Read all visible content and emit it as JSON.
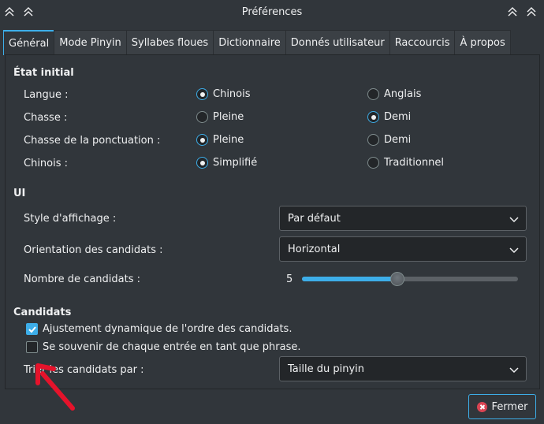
{
  "window": {
    "title": "Préférences"
  },
  "tabs": [
    {
      "label": "Général",
      "active": true
    },
    {
      "label": "Mode Pinyin",
      "active": false
    },
    {
      "label": "Syllabes floues",
      "active": false
    },
    {
      "label": "Dictionnaire",
      "active": false
    },
    {
      "label": "Donnés utilisateur",
      "active": false
    },
    {
      "label": "Raccourcis",
      "active": false
    },
    {
      "label": "À propos",
      "active": false
    }
  ],
  "initial_state": {
    "title": "État initial",
    "rows": [
      {
        "label": "Langue :",
        "option_a": "Chinois",
        "option_b": "Anglais",
        "selected": "a"
      },
      {
        "label": "Chasse :",
        "option_a": "Pleine",
        "option_b": "Demi",
        "selected": "b"
      },
      {
        "label": "Chasse de la ponctuation :",
        "option_a": "Pleine",
        "option_b": "Demi",
        "selected": "a"
      },
      {
        "label": "Chinois :",
        "option_a": "Simplifié",
        "option_b": "Traditionnel",
        "selected": "a"
      }
    ]
  },
  "ui": {
    "title": "UI",
    "display_style_label": "Style d'affichage :",
    "display_style_value": "Par défaut",
    "orientation_label": "Orientation des candidats :",
    "orientation_value": "Horizontal",
    "count_label": "Nombre de candidats :",
    "count_value": "5",
    "count_fraction": 0.44
  },
  "candidates": {
    "title": "Candidats",
    "dynamic_adjust_label": "Ajustement dynamique de l'ordre des candidats.",
    "dynamic_adjust_checked": true,
    "remember_label": "Se souvenir de chaque entrée en tant que phrase.",
    "remember_checked": false,
    "sort_label": "Trier les candidats par :",
    "sort_value": "Taille du pinyin"
  },
  "footer": {
    "close_label": "Fermer"
  },
  "colors": {
    "accent": "#3daee9",
    "background": "#31363b",
    "annotation_arrow": "#e5132b"
  }
}
